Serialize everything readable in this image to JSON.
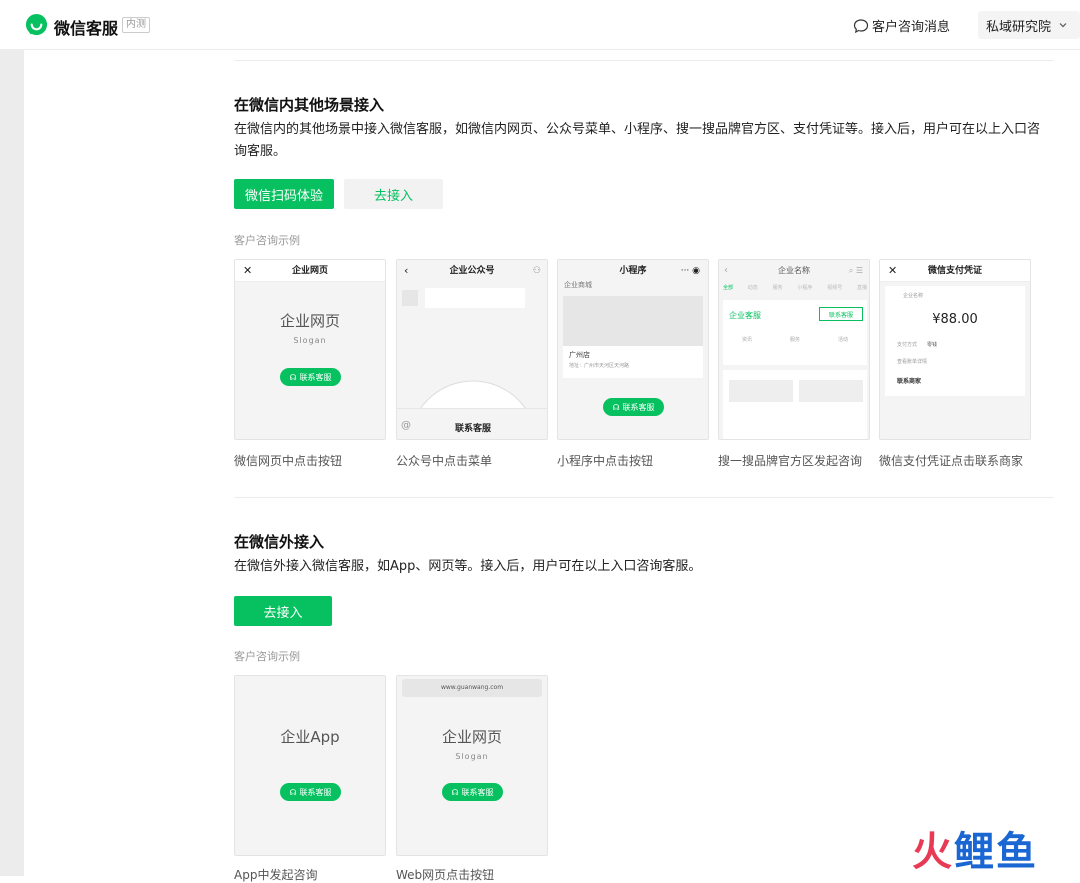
{
  "header": {
    "app_title": "微信客服",
    "beta_badge": "内测",
    "messages_link": "客户咨询消息",
    "account_name": "私域研究院"
  },
  "section_in": {
    "title": "在微信内其他场景接入",
    "desc": "在微信内的其他场景中接入微信客服，如微信内网页、公众号菜单、小程序、搜一搜品牌官方区、支付凭证等。接入后，用户可在以上入口咨询客服。",
    "scan_button": "微信扫码体验",
    "connect_button": "去接入",
    "example_label": "客户咨询示例",
    "cards": [
      {
        "header": "企业网页",
        "big": "企业网页",
        "slogan": "Slogan",
        "pill": "联系客服",
        "caption": "微信网页中点击按钮"
      },
      {
        "header": "企业公众号",
        "menu_label": "联系客服",
        "caption": "公众号中点击菜单"
      },
      {
        "header": "小程序",
        "shop": "企业商城",
        "store": "广州店",
        "store_addr": "地址：广州市天河区天河路",
        "pill": "联系客服",
        "caption": "小程序中点击按钮"
      },
      {
        "header": "企业名称",
        "service": "企业客服",
        "pill": "联系客服",
        "tabs": [
          "全部",
          "动态",
          "服务",
          "小程序",
          "视频号",
          "直播"
        ],
        "icons": [
          "资讯",
          "服务",
          "活动"
        ],
        "caption": "搜一搜品牌官方区发起咨询"
      },
      {
        "header": "微信支付凭证",
        "merchant": "企业名称",
        "amount": "¥88.00",
        "pay_method_label": "支付方式",
        "pay_method": "零钱",
        "more": "查看账单详情",
        "contact": "联系商家",
        "caption": "微信支付凭证点击联系商家"
      }
    ]
  },
  "section_out": {
    "title": "在微信外接入",
    "desc": "在微信外接入微信客服，如App、网页等。接入后，用户可在以上入口咨询客服。",
    "connect_button": "去接入",
    "example_label": "客户咨询示例",
    "cards": [
      {
        "big": "企业App",
        "pill": "联系客服",
        "caption": "App中发起咨询"
      },
      {
        "url": "www.guanwang.com",
        "big": "企业网页",
        "slogan": "Slogan",
        "pill": "联系客服",
        "caption": "Web网页点击按钮"
      }
    ]
  },
  "watermark": {
    "c1": "火",
    "c2": "鲤",
    "c3": "鱼"
  },
  "colors": {
    "brand_green": "#07c160",
    "watermark_red": "#e83a55",
    "watermark_blue": "#1a66d2"
  }
}
